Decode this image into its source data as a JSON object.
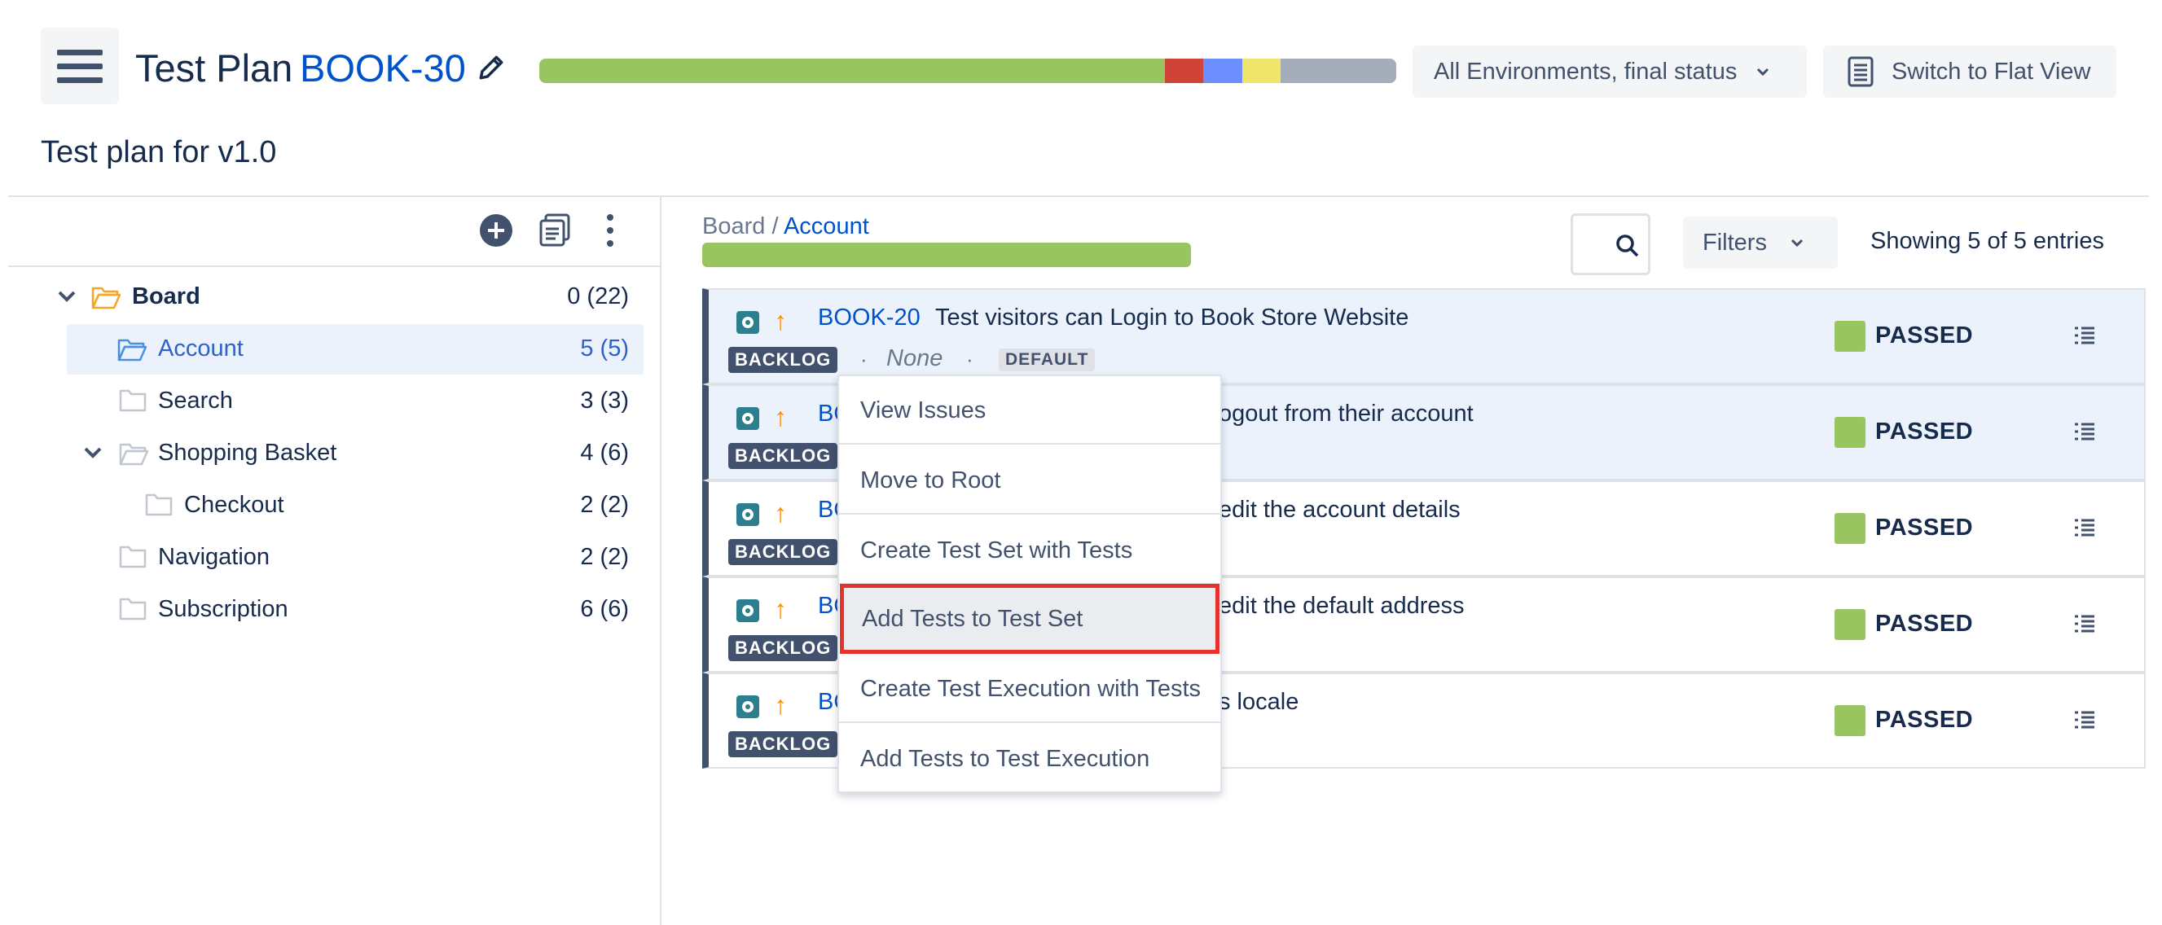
{
  "header": {
    "title": "Test Plan",
    "key": "BOOK-30",
    "description": "Test plan for v1.0",
    "progress": [
      {
        "status": "passed",
        "fraction": 0.73,
        "color": "#99c560"
      },
      {
        "status": "failed",
        "fraction": 0.045,
        "color": "#d04437"
      },
      {
        "status": "executing",
        "fraction": 0.045,
        "color": "#6d8eff"
      },
      {
        "status": "todo",
        "fraction": 0.045,
        "color": "#f1e46a"
      },
      {
        "status": "other",
        "fraction": 0.135,
        "color": "#a5adba"
      }
    ],
    "environment_select": "All Environments, final status",
    "flat_view_label": "Switch to Flat View"
  },
  "tree": [
    {
      "label": "Board",
      "count": "0 (22)",
      "bold": true,
      "expanded": true
    },
    {
      "label": "Account",
      "count": "5 (5)",
      "selected": true
    },
    {
      "label": "Search",
      "count": "3 (3)"
    },
    {
      "label": "Shopping Basket",
      "count": "4 (6)",
      "expanded": true
    },
    {
      "label": "Checkout",
      "count": "2 (2)"
    },
    {
      "label": "Navigation",
      "count": "2 (2)"
    },
    {
      "label": "Subscription",
      "count": "6 (6)"
    }
  ],
  "content": {
    "breadcrumb_root": "Board",
    "breadcrumb_sep": " / ",
    "breadcrumb_current": "Account",
    "folder_progress": {
      "passed_fraction": 1.0,
      "color": "#99c560"
    },
    "filters_label": "Filters",
    "showing": "Showing 5 of 5 entries"
  },
  "tests": [
    {
      "key": "BOOK-20",
      "summary": "Test visitors can Login to Book Store Website",
      "status": "BACKLOG",
      "extra": "None",
      "env": "DEFAULT",
      "result": "PASSED"
    },
    {
      "key": "BO",
      "summary": "ogout from their account",
      "status": "BACKLOG",
      "result": "PASSED"
    },
    {
      "key": "BO",
      "summary": "edit the account details",
      "status": "BACKLOG",
      "result": "PASSED"
    },
    {
      "key": "BO",
      "summary": "edit the default address",
      "status": "BACKLOG",
      "result": "PASSED"
    },
    {
      "key": "BO",
      "summary": "s locale",
      "status": "BACKLOG",
      "result": "PASSED"
    }
  ],
  "bullet": "·",
  "context_menu": [
    "View Issues",
    "Move to Root",
    "Create Test Set with Tests",
    "Add Tests to Test Set",
    "Create Test Execution with Tests",
    "Add Tests to Test Execution"
  ],
  "colors": {
    "accent": "#0052cc",
    "passed": "#99c560",
    "highlight_outline": "#e5322d"
  }
}
